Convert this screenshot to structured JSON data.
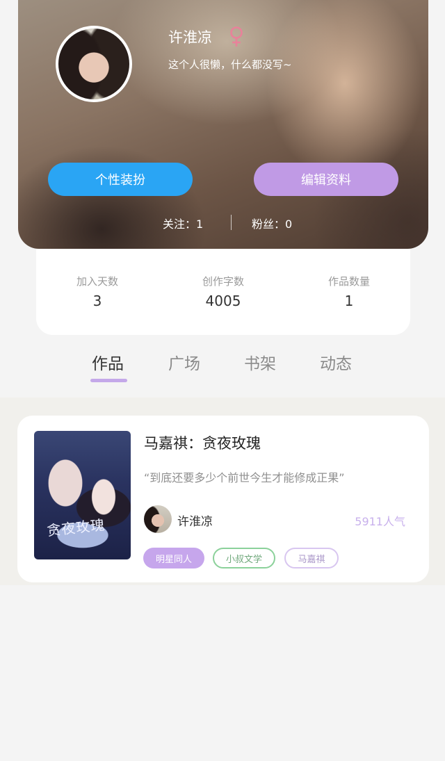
{
  "profile": {
    "username": "许淮凉",
    "signature": "这个人很懒，什么都没写~",
    "gender_icon": "female-icon",
    "gender_color": "#e8829a",
    "buttons": {
      "dress_label": "个性装扮",
      "edit_label": "编辑资料"
    },
    "follow": {
      "following_label": "关注：",
      "following_count": "1",
      "fans_label": "粉丝：",
      "fans_count": "0"
    }
  },
  "stats": [
    {
      "label": "加入天数",
      "value": "3"
    },
    {
      "label": "创作字数",
      "value": "4005"
    },
    {
      "label": "作品数量",
      "value": "1"
    }
  ],
  "tabs": [
    {
      "label": "作品",
      "active": true
    },
    {
      "label": "广场",
      "active": false
    },
    {
      "label": "书架",
      "active": false
    },
    {
      "label": "动态",
      "active": false
    }
  ],
  "works": [
    {
      "cover_text": "贪夜玫瑰",
      "title": "马嘉祺：贪夜玫瑰",
      "quote": "“到底还要多少个前世今生才能修成正果”",
      "author": "许淮凉",
      "popularity": "5911人气",
      "tags": [
        "明星同人",
        "小叔文学",
        "马嘉祺"
      ]
    }
  ],
  "colors": {
    "dress_button": "#2aa5f4",
    "edit_button": "#c09ae5",
    "tab_underline": "#c4a8e9",
    "popularity": "#c8b1ec"
  }
}
